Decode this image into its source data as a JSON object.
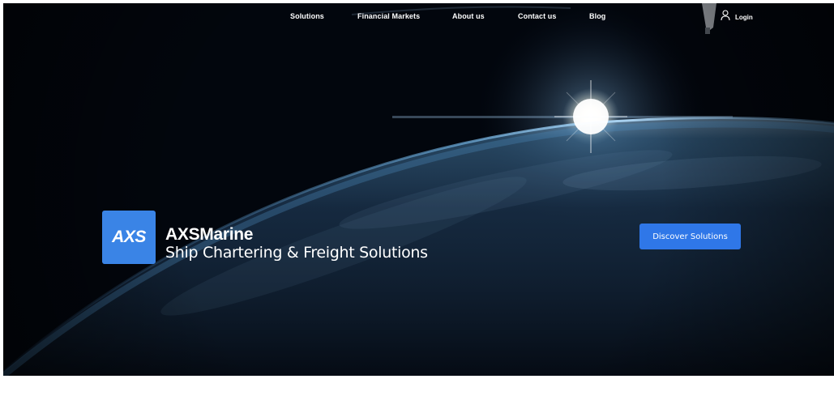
{
  "colors": {
    "accent": "#2f77e8",
    "logo_bg": "#3a84e6",
    "background": "#02060d",
    "text": "#ffffff"
  },
  "nav": {
    "items": [
      {
        "label": "Solutions"
      },
      {
        "label": "Financial Markets"
      },
      {
        "label": "About us"
      },
      {
        "label": "Contact us"
      },
      {
        "label": "Blog"
      }
    ],
    "login": {
      "label": "Login",
      "icon": "user-icon"
    }
  },
  "hero": {
    "logo_text": "AXS",
    "brand_name": "AXSMarine",
    "tagline": "Ship Chartering & Freight Solutions",
    "cta_label": "Discover Solutions"
  }
}
